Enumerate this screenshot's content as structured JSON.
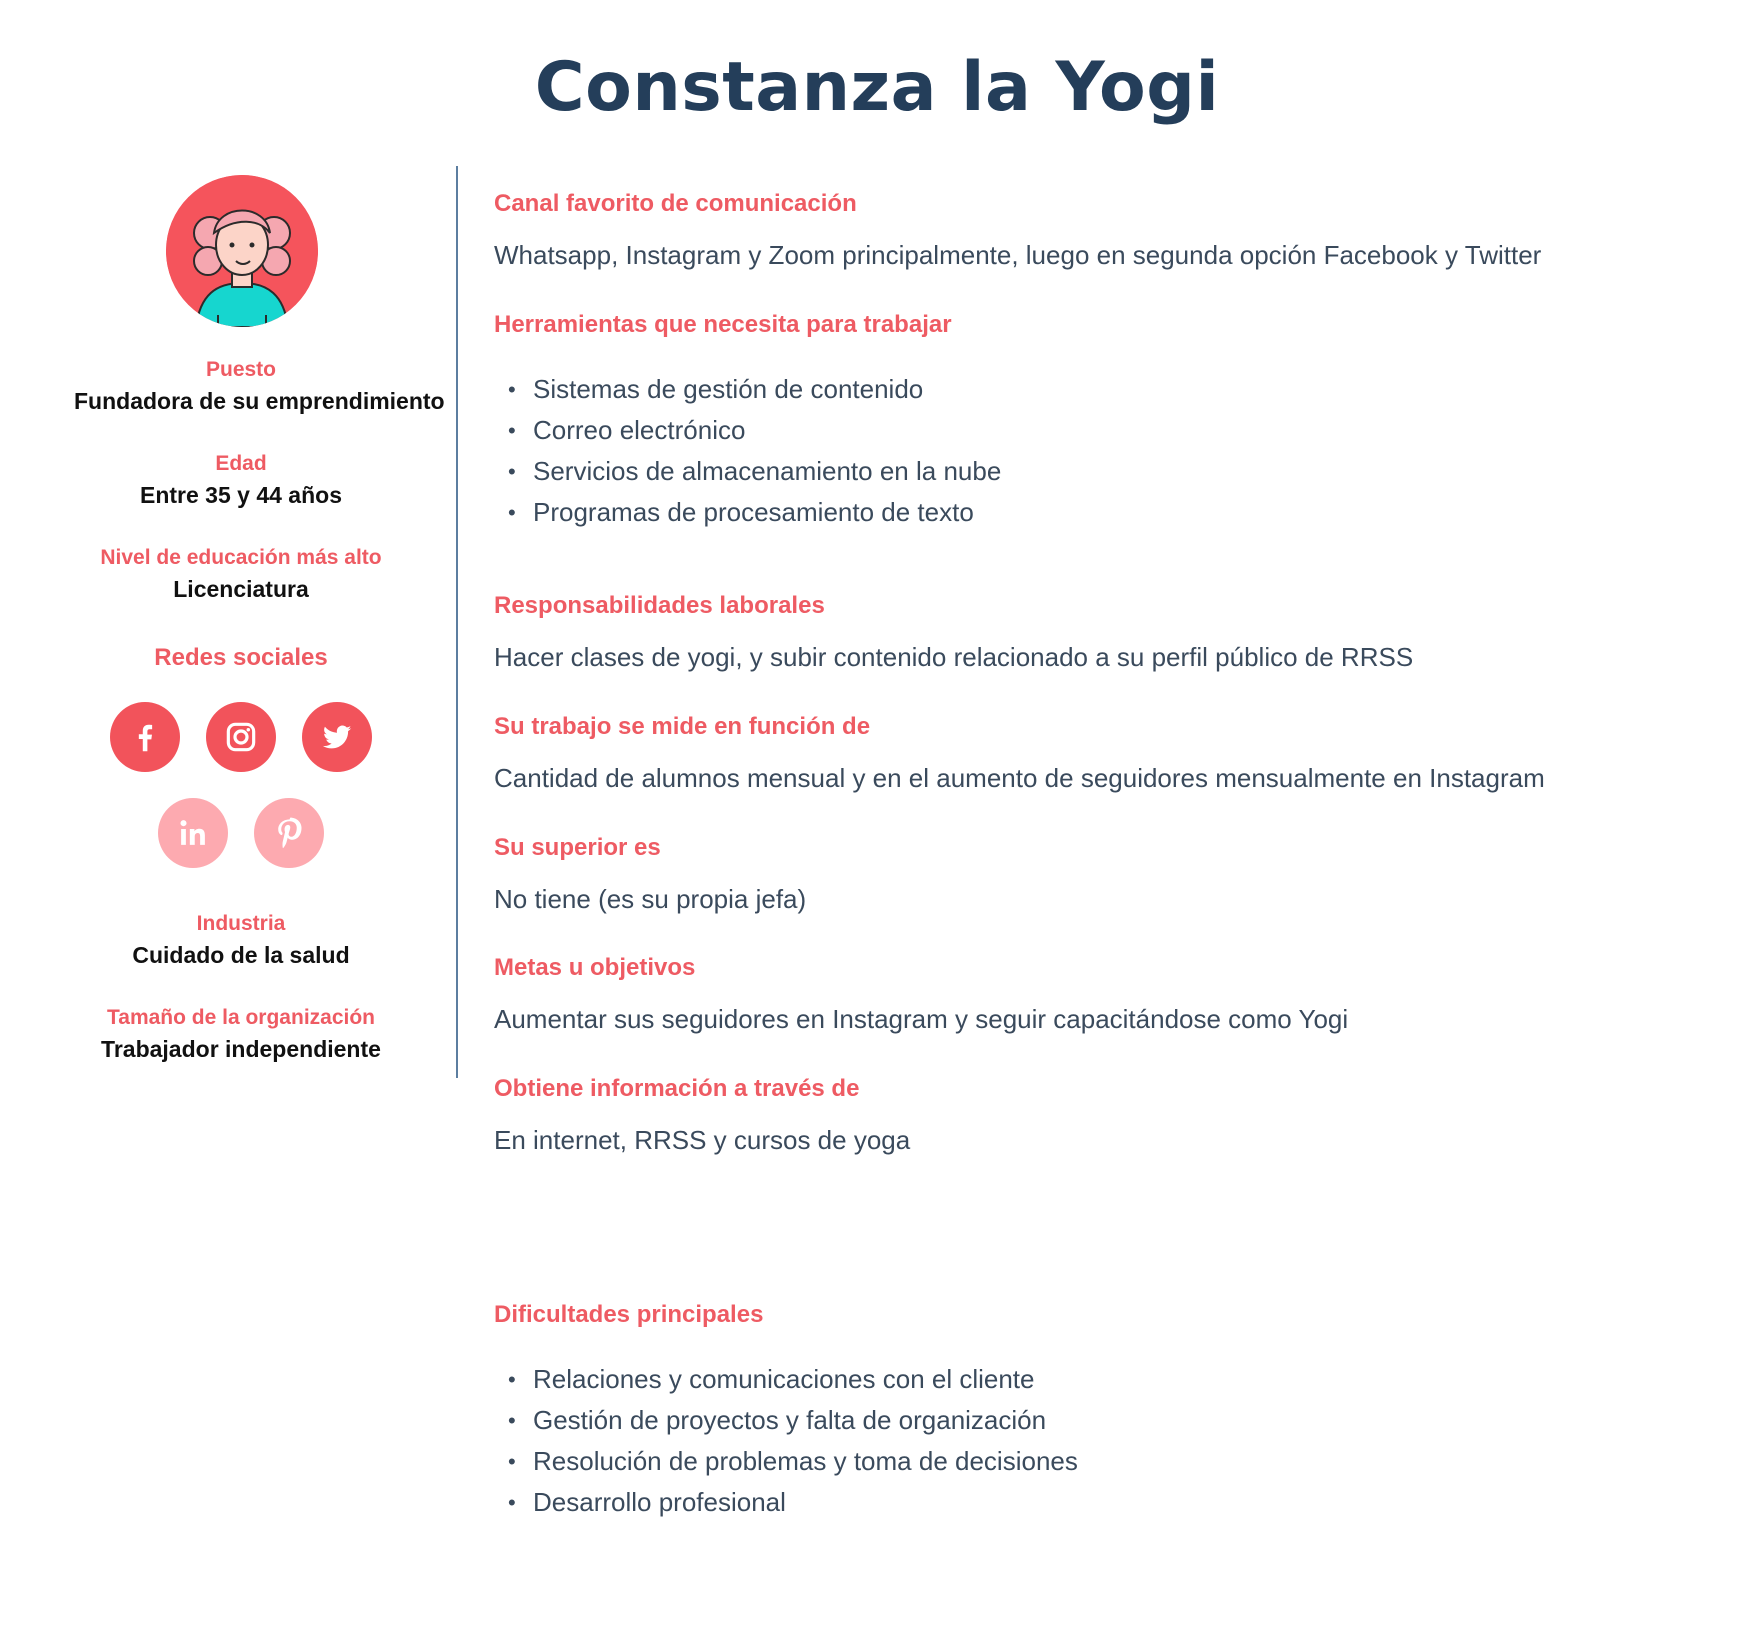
{
  "title": "Constanza la Yogi",
  "profile": {
    "puesto": {
      "label": "Puesto",
      "value": "Fundadora de su emprendimiento"
    },
    "edad": {
      "label": "Edad",
      "value": "Entre 35 y 44 años"
    },
    "educacion": {
      "label": "Nivel de educación más alto",
      "value": "Licenciatura"
    },
    "redes_heading": "Redes sociales",
    "social_networks": [
      {
        "name": "facebook",
        "active": true
      },
      {
        "name": "instagram",
        "active": true
      },
      {
        "name": "twitter",
        "active": true
      },
      {
        "name": "linkedin",
        "active": false
      },
      {
        "name": "pinterest",
        "active": false
      }
    ],
    "industria": {
      "label": "Industria",
      "value": "Cuidado de la salud"
    },
    "tamano": {
      "label": "Tamaño de la organización",
      "value": "Trabajador independiente"
    }
  },
  "sections": {
    "canal": {
      "label": "Canal favorito de comunicación",
      "text": "Whatsapp, Instagram y Zoom principalmente, luego en segunda opción Facebook y Twitter"
    },
    "herramientas": {
      "label": "Herramientas que necesita para trabajar",
      "items": [
        "Sistemas de gestión de contenido",
        "Correo electrónico",
        "Servicios de almacenamiento en la nube",
        "Programas de procesamiento de texto"
      ]
    },
    "responsabilidades": {
      "label": "Responsabilidades laborales",
      "text": "Hacer clases de yogi, y subir contenido relacionado a su perfil público de RRSS"
    },
    "medicion": {
      "label": "Su trabajo se mide en función de",
      "text": "Cantidad de alumnos mensual y en el aumento de seguidores mensualmente en Instagram"
    },
    "superior": {
      "label": "Su superior es",
      "text": "No tiene (es su propia jefa)"
    },
    "metas": {
      "label": "Metas u objetivos",
      "text": "Aumentar sus seguidores en Instagram y seguir capacitándose como Yogi"
    },
    "informacion": {
      "label": "Obtiene información a través de",
      "text": "En internet, RRSS y cursos de yoga"
    },
    "dificultades": {
      "label": "Dificultades principales",
      "items": [
        "Relaciones y comunicaciones con el cliente",
        "Gestión de proyectos y falta de organización",
        "Resolución de problemas y toma de decisiones",
        "Desarrollo profesional"
      ]
    }
  },
  "colors": {
    "title": "#243e5a",
    "accent": "#ee5b63",
    "social_active": "#f2535b",
    "social_inactive": "#fdaab0",
    "divider": "#5c7ea0"
  }
}
